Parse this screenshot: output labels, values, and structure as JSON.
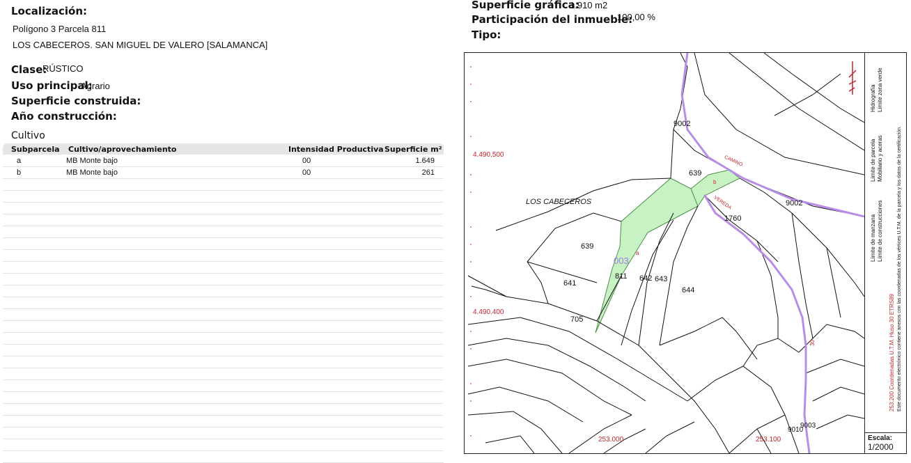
{
  "location": {
    "title": "Localización:",
    "line1": "Polígono 3 Parcela 811",
    "line2": "LOS CABECEROS. SAN MIGUEL DE VALERO [SALAMANCA]"
  },
  "attributes": {
    "clase_label": "Clase:",
    "clase_value": "RÚSTICO",
    "uso_label": "Uso principal:",
    "uso_value": "Agrario",
    "superficie_construida_label": "Superficie construida:",
    "anio_label": "Año construcción:"
  },
  "summary": {
    "superficie_grafica_label": "Superficie gráfica:",
    "superficie_grafica_value": "1.910 m2",
    "participacion_label": "Participación del inmueble:",
    "participacion_value": "100,00 %",
    "tipo_label": "Tipo:"
  },
  "cultivo": {
    "title": "Cultivo",
    "headers": [
      "Subparcela",
      "Cultivo/aprovechamiento",
      "Intensidad Productiva",
      "Superficie m²"
    ],
    "rows": [
      [
        "a",
        "MB Monte bajo",
        "00",
        "1.649"
      ],
      [
        "b",
        "MB Monte bajo",
        "00",
        "261"
      ]
    ],
    "empty_rows": 24
  },
  "map": {
    "coord_labels": {
      "y1": "4.490.500",
      "y2": "4.490.400",
      "x1": "253.000",
      "x2": "253.100"
    },
    "place_name": "LOS CABECEROS",
    "parcel_labels": [
      "9002",
      "639",
      "1760",
      "639",
      "811",
      "642",
      "643",
      "644",
      "641",
      "705",
      "9003",
      "9010",
      "9002"
    ],
    "subparcel_labels": [
      "a",
      "b"
    ],
    "poly_number": "003",
    "road_labels": [
      "CAMINO",
      "VEREDA",
      "30"
    ],
    "legend": {
      "items": [
        "Límite de manzana",
        "Límite de parcela",
        "Hidrografía",
        "Límite de construcciones",
        "Mobiliario y aceras",
        "Límite zona verde"
      ],
      "coords_note": "253.200 Coordenadas U.T.M. Huso 30 ETRS89",
      "doc_note": "Este documento electrónico contiene anexos con las coordenadas de los vértices U.T.M. de la parcela y los datos de la certificación."
    },
    "scale_label": "Escala:",
    "scale_value": "1/2000"
  },
  "colors": {
    "parcel_fill": "#c9f2c4",
    "hydro": "#b98ce8",
    "coord_red": "#c0272d"
  }
}
